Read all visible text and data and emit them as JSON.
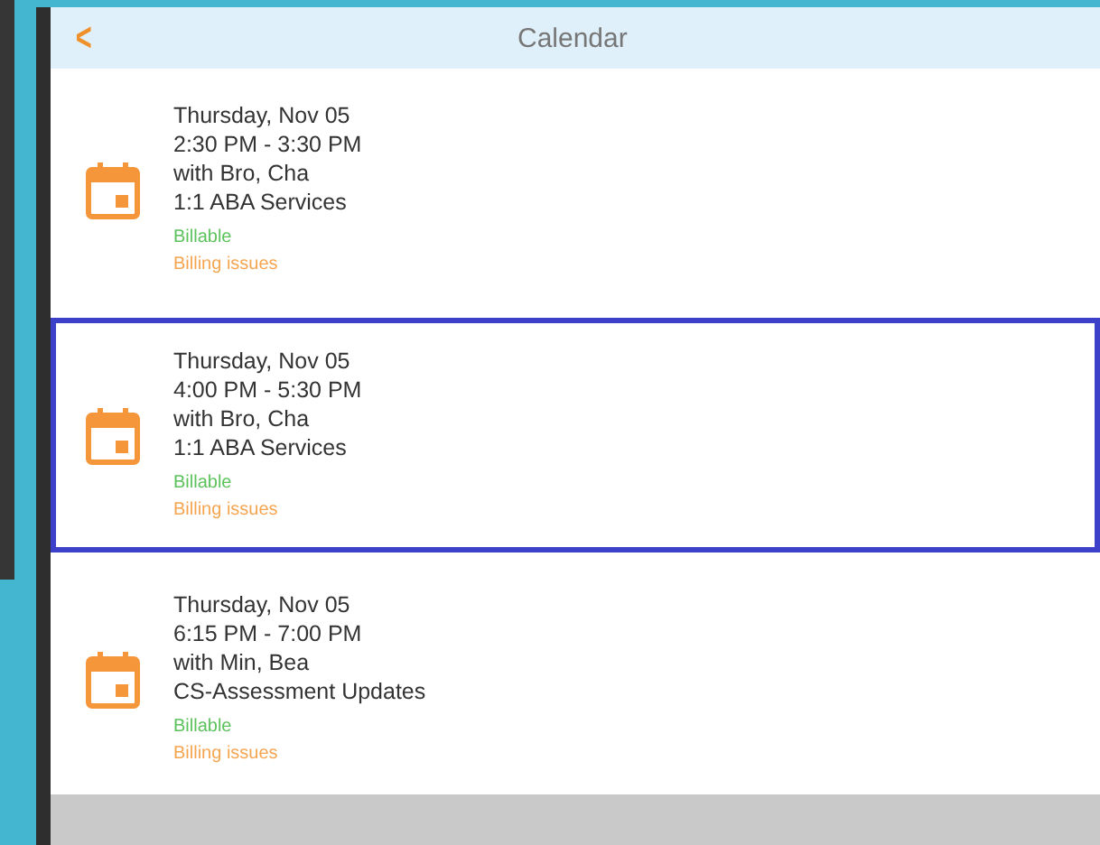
{
  "header": {
    "back": "<",
    "title": "Calendar"
  },
  "appointments": [
    {
      "date": "Thursday, Nov 05",
      "time": "2:30 PM - 3:30 PM",
      "with": "with Bro, Cha",
      "service": "1:1 ABA Services",
      "billable": "Billable",
      "issues": "Billing issues",
      "selected": false
    },
    {
      "date": "Thursday, Nov 05",
      "time": "4:00 PM - 5:30 PM",
      "with": "with Bro, Cha",
      "service": "1:1 ABA Services",
      "billable": "Billable",
      "issues": "Billing issues",
      "selected": true
    },
    {
      "date": "Thursday, Nov 05",
      "time": "6:15 PM - 7:00 PM",
      "with": "with Min, Bea",
      "service": "CS-Assessment Updates",
      "billable": "Billable",
      "issues": "Billing issues",
      "selected": false
    }
  ]
}
